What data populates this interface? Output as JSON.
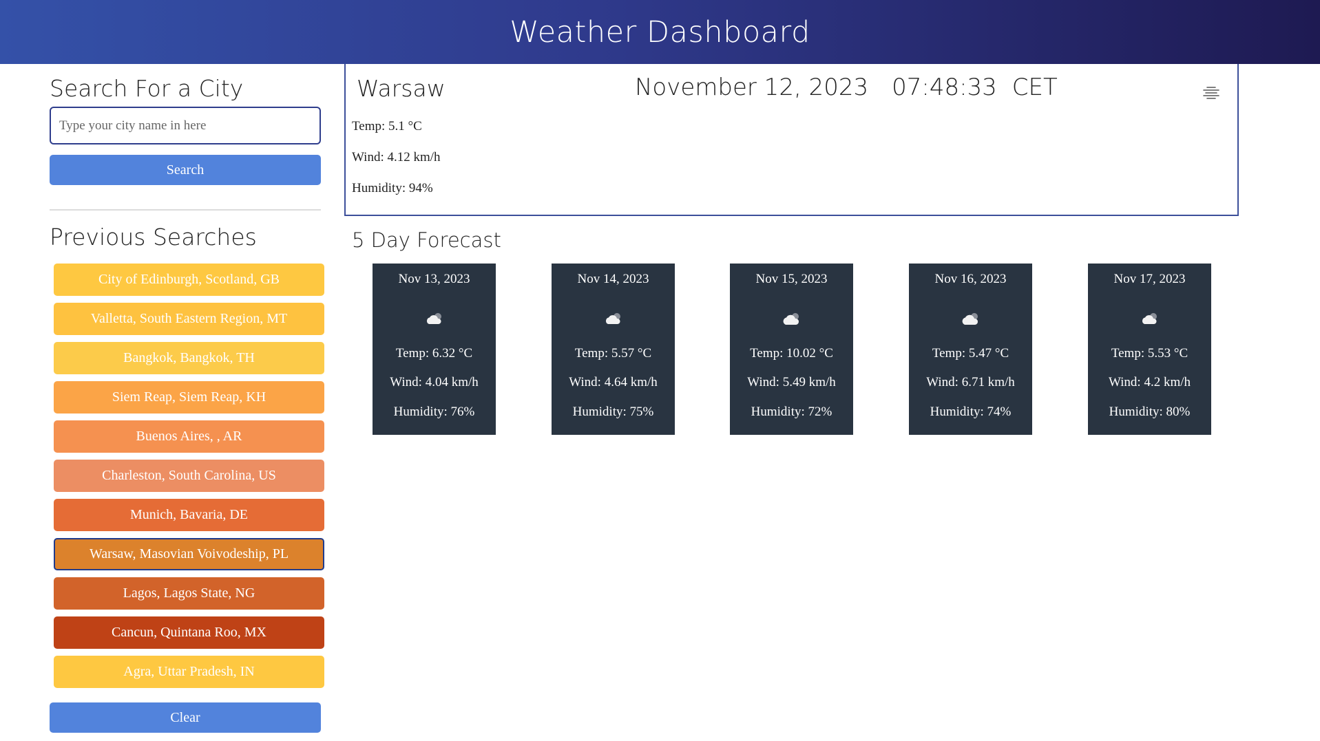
{
  "header": {
    "title": "Weather Dashboard"
  },
  "sidebar": {
    "search_heading": "Search For a City",
    "search_placeholder": "Type your city name in here",
    "search_button": "Search",
    "previous_heading": "Previous Searches",
    "history": [
      {
        "label": "City of Edinburgh, Scotland, GB",
        "color": "#fec841"
      },
      {
        "label": "Valletta, South Eastern Region, MT",
        "color": "#fec240"
      },
      {
        "label": "Bangkok, Bangkok, TH",
        "color": "#fccb4a"
      },
      {
        "label": "Siem Reap, Siem Reap, KH",
        "color": "#fba447"
      },
      {
        "label": "Buenos Aires, , AR",
        "color": "#f59150"
      },
      {
        "label": "Charleston, South Carolina, US",
        "color": "#ec8e63"
      },
      {
        "label": "Munich, Bavaria, DE",
        "color": "#e56c36"
      },
      {
        "label": "Warsaw, Masovian Voivodeship, PL",
        "color": "#dc822c",
        "active": true
      },
      {
        "label": "Lagos, Lagos State, NG",
        "color": "#d2632a"
      },
      {
        "label": "Cancun, Quintana Roo, MX",
        "color": "#bf4216"
      },
      {
        "label": "Agra, Uttar Pradesh, IN",
        "color": "#fec841"
      }
    ],
    "clear_button": "Clear"
  },
  "current": {
    "city": "Warsaw",
    "date": "November 12, 2023",
    "time": "07:48:33",
    "timezone": "CET",
    "icon": "mist-icon",
    "temp": "Temp: 5.1 °C",
    "wind": "Wind: 4.12 km/h",
    "humidity": "Humidity: 94%"
  },
  "forecast": {
    "heading": "5 Day Forecast",
    "days": [
      {
        "date": "Nov 13, 2023",
        "icon": "cloud-icon",
        "temp": "Temp: 6.32 °C",
        "wind": "Wind: 4.04 km/h",
        "humidity": "Humidity: 76%"
      },
      {
        "date": "Nov 14, 2023",
        "icon": "cloud-icon",
        "temp": "Temp: 5.57 °C",
        "wind": "Wind: 4.64 km/h",
        "humidity": "Humidity: 75%"
      },
      {
        "date": "Nov 15, 2023",
        "icon": "cloud-icon",
        "temp": "Temp: 10.02 °C",
        "wind": "Wind: 5.49 km/h",
        "humidity": "Humidity: 72%"
      },
      {
        "date": "Nov 16, 2023",
        "icon": "cloud-icon",
        "temp": "Temp: 5.47 °C",
        "wind": "Wind: 6.71 km/h",
        "humidity": "Humidity: 74%"
      },
      {
        "date": "Nov 17, 2023",
        "icon": "cloud-icon",
        "temp": "Temp: 5.53 °C",
        "wind": "Wind: 4.2 km/h",
        "humidity": "Humidity: 80%"
      }
    ]
  }
}
